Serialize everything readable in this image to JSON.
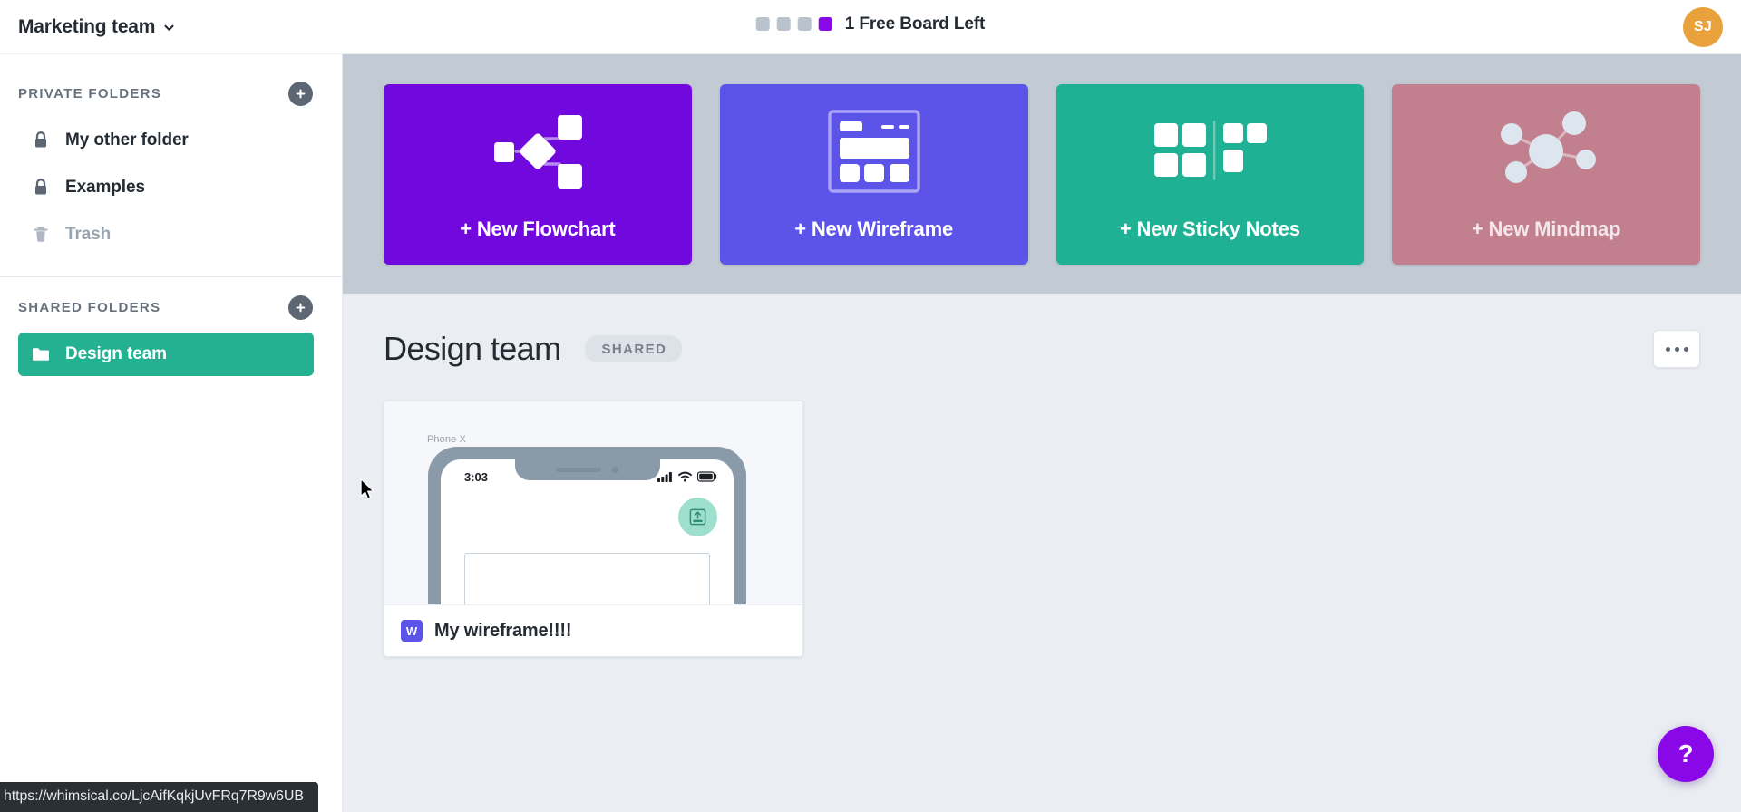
{
  "topbar": {
    "team_name": "Marketing team",
    "chevron_icon": "chevron-down-icon",
    "board_counter": {
      "text": "1 Free Board Left",
      "total_slots": 4,
      "filled_slots": 1,
      "empty_color": "#b9c2cd",
      "filled_color": "#8a08e8"
    },
    "avatar": {
      "initials": "SJ",
      "color": "#e9a13b"
    }
  },
  "sidebar": {
    "private": {
      "title": "PRIVATE FOLDERS",
      "add_label": "+",
      "items": [
        {
          "label": "My other folder",
          "icon": "lock-icon",
          "state": "normal"
        },
        {
          "label": "Examples",
          "icon": "lock-icon",
          "state": "normal"
        },
        {
          "label": "Trash",
          "icon": "trash-icon",
          "state": "muted"
        }
      ]
    },
    "shared": {
      "title": "SHARED FOLDERS",
      "add_label": "+",
      "items": [
        {
          "label": "Design team",
          "icon": "folder-icon",
          "state": "active"
        }
      ]
    },
    "active_color": "#24b191"
  },
  "create_cards": [
    {
      "label": "+ New Flowchart",
      "art": "flowchart-icon",
      "color": "#7109de"
    },
    {
      "label": "+ New Wireframe",
      "art": "wireframe-icon",
      "color": "#5c53e8"
    },
    {
      "label": "+ New Sticky Notes",
      "art": "sticky-notes-icon",
      "color": "#1eb193"
    },
    {
      "label": "+ New Mindmap",
      "art": "mindmap-icon",
      "color": "#c2808f"
    }
  ],
  "content": {
    "title": "Design team",
    "badge": "SHARED",
    "more_button": "more-options-icon",
    "boards": [
      {
        "name": "My wireframe!!!!",
        "type_initial": "W",
        "type_color": "#5c53e8",
        "thumbnail": {
          "caption": "Phone X",
          "status_time": "3:03",
          "status_icons": [
            "cellular-signal-icon",
            "wifi-icon",
            "battery-icon"
          ],
          "fab_icon": "save-to-library-icon",
          "fab_color": "#9ee0cd",
          "frame_color": "#8b9aa9"
        }
      }
    ]
  },
  "help_button": {
    "label": "?",
    "color": "#8a08e8"
  },
  "status_bar": {
    "url": "https://whimsical.co/LjcAifKqkjUvFRq7R9w6UB"
  }
}
